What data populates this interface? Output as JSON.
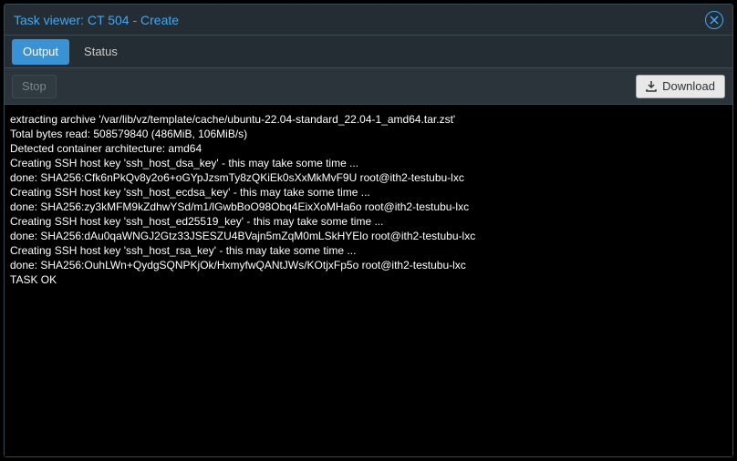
{
  "window": {
    "title": "Task viewer: CT 504 - Create"
  },
  "tabs": {
    "output": "Output",
    "status": "Status"
  },
  "toolbar": {
    "stop": "Stop",
    "download": "Download"
  },
  "log_lines": [
    "extracting archive '/var/lib/vz/template/cache/ubuntu-22.04-standard_22.04-1_amd64.tar.zst'",
    "Total bytes read: 508579840 (486MiB, 106MiB/s)",
    "Detected container architecture: amd64",
    "Creating SSH host key 'ssh_host_dsa_key' - this may take some time ...",
    "done: SHA256:Cfk6nPkQv8y2o6+oGYpJzsmTy8zQKiEk0sXxMkMvF9U root@ith2-testubu-lxc",
    "Creating SSH host key 'ssh_host_ecdsa_key' - this may take some time ...",
    "done: SHA256:zy3kMFM9kZdhwYSd/m1/lGwbBoO98Obq4EixXoMHa6o root@ith2-testubu-lxc",
    "Creating SSH host key 'ssh_host_ed25519_key' - this may take some time ...",
    "done: SHA256:dAu0qaWNGJ2Gtz33JSESZU4BVajn5mZqM0mLSkHYElo root@ith2-testubu-lxc",
    "Creating SSH host key 'ssh_host_rsa_key' - this may take some time ...",
    "done: SHA256:OuhLWn+QydgSQNPKjOk/HxmyfwQANtJWs/KOtjxFp5o root@ith2-testubu-lxc",
    "TASK OK"
  ]
}
